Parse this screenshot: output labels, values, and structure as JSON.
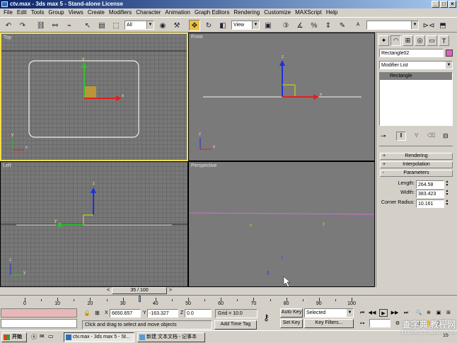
{
  "window": {
    "title": "ctv.max - 3ds max 5 - Stand-alone License",
    "min_glyph": "_",
    "max_glyph": "□",
    "close_glyph": "×"
  },
  "menu": [
    "File",
    "Edit",
    "Tools",
    "Group",
    "Views",
    "Create",
    "Modifiers",
    "Character",
    "Animation",
    "Graph Editors",
    "Rendering",
    "Customize",
    "MAXScript",
    "Help"
  ],
  "toolbar": {
    "selection_filter": "All",
    "reference_coord": "View",
    "named_selection": "",
    "active_tool": "select-and-move"
  },
  "viewports": {
    "top": {
      "label": "Top",
      "active": true
    },
    "front": {
      "label": "Front"
    },
    "left": {
      "label": "Left"
    },
    "perspective": {
      "label": "Perspective"
    },
    "axis_labels": {
      "x": "x",
      "y": "y",
      "z": "z"
    }
  },
  "command_panel": {
    "object_name": "Rectangle02",
    "object_color": "#e060c0",
    "modifier_list": "Modifier List",
    "stack_items": [
      "Rectangle"
    ],
    "rollouts": [
      {
        "sign": "+",
        "label": "Rendering"
      },
      {
        "sign": "+",
        "label": "Interpolation"
      },
      {
        "sign": "-",
        "label": "Parameters"
      }
    ],
    "params": [
      {
        "label": "Length:",
        "value": "264.58"
      },
      {
        "label": "Width:",
        "value": "383.423"
      },
      {
        "label": "Corner Radius:",
        "value": "10.161"
      }
    ]
  },
  "time": {
    "slider_label": "35 / 100",
    "ticks": [
      "0",
      "10",
      "20",
      "30",
      "40",
      "50",
      "60",
      "70",
      "80",
      "90",
      "100"
    ],
    "current_frame": 35
  },
  "status": {
    "x_label": "X",
    "y_label": "Y",
    "z_label": "Z",
    "x_value": "6650.657",
    "y_value": "-163.327",
    "z_value": "0.0",
    "grid": "Grid = 10.0",
    "prompt": "Click and drag to select and move objects",
    "add_time_tag": "Add Time Tag",
    "auto_key": "Auto Key",
    "set_key": "Set Key",
    "key_mode": "Selected",
    "key_filters": "Key Filters..."
  },
  "taskbar": {
    "start": "开始",
    "tasks": [
      "ctv.max - 3ds max 5 - St...",
      "新建 文本文档 - 记事本"
    ],
    "time": "15"
  },
  "watermark": {
    "line1": "查字典 教程网",
    "line2": "jiaocheng.chazidian.com"
  }
}
